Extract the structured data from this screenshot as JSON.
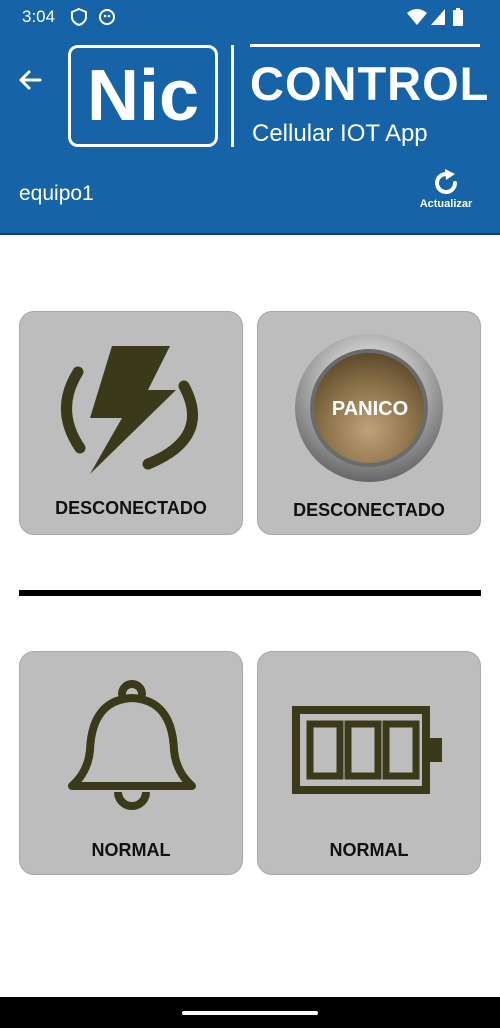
{
  "status_bar": {
    "time": "3:04"
  },
  "header": {
    "logo_nic": "Nic",
    "logo_control": "CONTROL",
    "logo_subtitle": "Cellular IOT App",
    "device_name": "equipo1",
    "refresh_label": "Actualizar"
  },
  "cards": {
    "power": {
      "status": "DESCONECTADO",
      "icon": "lightning-icon"
    },
    "panic": {
      "button_label": "PANICO",
      "status": "DESCONECTADO",
      "icon": "panic-button-icon"
    },
    "alarm": {
      "status": "NORMAL",
      "icon": "bell-icon"
    },
    "battery": {
      "status": "NORMAL",
      "icon": "battery-icon"
    }
  },
  "colors": {
    "header": "#1663a7",
    "card": "#bdbdbd",
    "icon": "#3a3a1a"
  }
}
